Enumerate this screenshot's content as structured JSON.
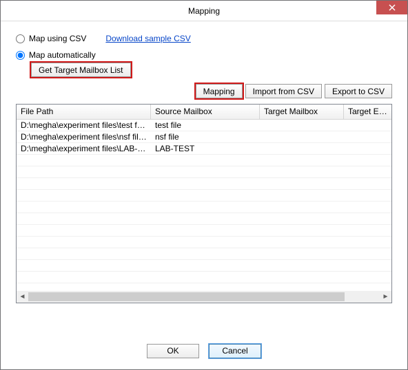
{
  "window": {
    "title": "Mapping",
    "close_tooltip": "Close"
  },
  "options": {
    "map_csv_label": "Map using CSV",
    "download_link": "Download sample CSV",
    "map_auto_label": "Map automatically",
    "get_target_label": "Get Target Mailbox List"
  },
  "actions": {
    "mapping": "Mapping",
    "import": "Import from CSV",
    "export": "Export to CSV"
  },
  "table": {
    "headers": {
      "file_path": "File Path",
      "source_mailbox": "Source Mailbox",
      "target_mailbox": "Target Mailbox",
      "target_email": "Target Email"
    },
    "rows": [
      {
        "file_path": "D:\\megha\\experiment files\\test file.nsf",
        "source_mailbox": "test file",
        "target_mailbox": "",
        "target_email": ""
      },
      {
        "file_path": "D:\\megha\\experiment files\\nsf file.nsf",
        "source_mailbox": "nsf file",
        "target_mailbox": "",
        "target_email": ""
      },
      {
        "file_path": "D:\\megha\\experiment files\\LAB-TEST...",
        "source_mailbox": "LAB-TEST",
        "target_mailbox": "",
        "target_email": ""
      }
    ]
  },
  "footer": {
    "ok": "OK",
    "cancel": "Cancel"
  }
}
